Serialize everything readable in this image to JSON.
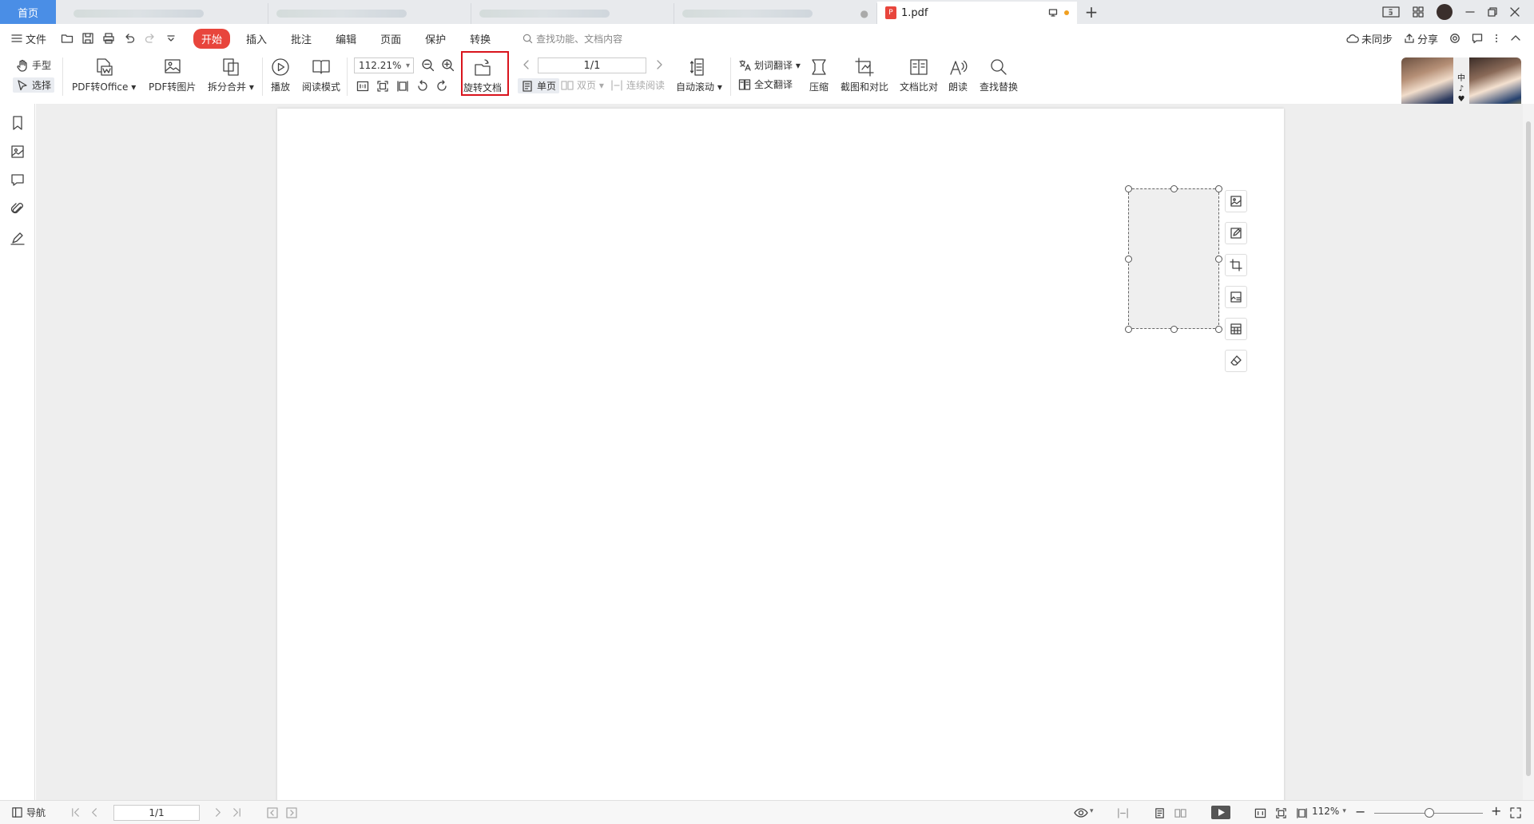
{
  "titlebar": {
    "home_tab": "首页",
    "active_tab": "1.pdf",
    "pdf_badge": "P",
    "new_tab": "+"
  },
  "menubar": {
    "file": "文件",
    "tabs": [
      "开始",
      "插入",
      "批注",
      "编辑",
      "页面",
      "保护",
      "转换"
    ],
    "search_placeholder": "查找功能、文档内容",
    "sync": "未同步",
    "share": "分享"
  },
  "toolbar": {
    "hand": "手型",
    "select": "选择",
    "pdf_to_office": "PDF转Office",
    "pdf_to_image": "PDF转图片",
    "split_merge": "拆分合并",
    "play": "播放",
    "read_mode": "阅读模式",
    "zoom_value": "112.21%",
    "rotate_doc": "旋转文档",
    "page_value": "1/1",
    "single_page": "单页",
    "double_page": "双页",
    "continuous": "连续阅读",
    "auto_scroll": "自动滚动",
    "word_translate": "划词翻译",
    "full_translate": "全文翻译",
    "compress": "压缩",
    "screenshot_compare": "截图和对比",
    "doc_compare": "文档比对",
    "read_aloud": "朗读",
    "find_replace": "查找替换"
  },
  "portrait": {
    "mid_text": [
      "中",
      "♪",
      "♥"
    ]
  },
  "statusbar": {
    "nav": "导航",
    "page_value": "1/1",
    "zoom": "112%"
  },
  "colors": {
    "accent_red": "#e8453c",
    "highlight_red": "#d9141d",
    "home_blue": "#4a8ee6"
  }
}
